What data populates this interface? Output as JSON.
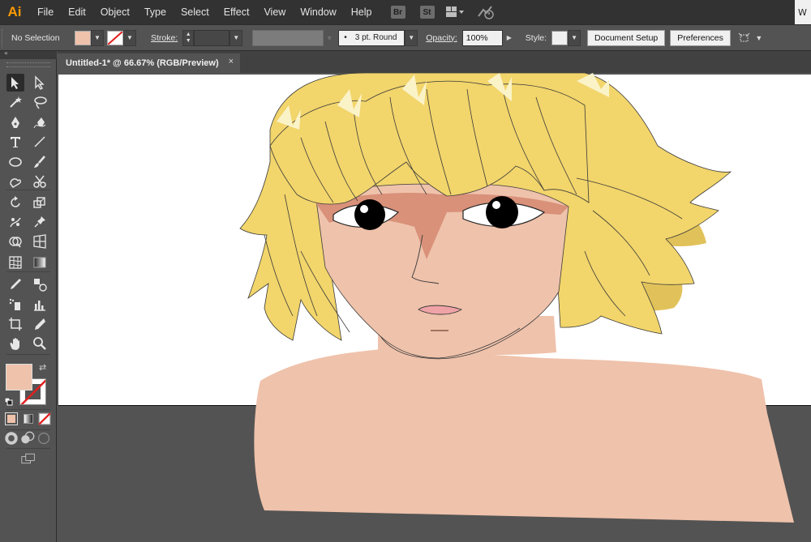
{
  "app": {
    "logo": "Ai"
  },
  "menu": {
    "items": [
      "File",
      "Edit",
      "Object",
      "Type",
      "Select",
      "Effect",
      "View",
      "Window",
      "Help"
    ],
    "bridge_label": "Br",
    "stock_label": "St",
    "right_fragment": "W"
  },
  "control": {
    "selection_label": "No Selection",
    "fill_color": "#efc2ab",
    "stroke_label": "Stroke:",
    "brush_label": "3 pt. Round",
    "opacity_label": "Opacity:",
    "opacity_value": "100%",
    "style_label": "Style:",
    "document_setup": "Document Setup",
    "preferences": "Preferences"
  },
  "document": {
    "tab_title": "Untitled-1* @ 66.67% (RGB/Preview)",
    "close_glyph": "×"
  },
  "tools": [
    "selection-tool",
    "direct-selection-tool",
    "magic-wand-tool",
    "lasso-tool",
    "pen-tool",
    "curvature-tool",
    "type-tool",
    "line-segment-tool",
    "ellipse-tool",
    "paintbrush-tool",
    "shaper-tool",
    "scissors-tool",
    "rotate-tool",
    "scale-tool",
    "puppet-warp-tool",
    "pin-tool",
    "shape-builder-tool",
    "perspective-grid-tool",
    "mesh-tool",
    "gradient-tool",
    "eyedropper-tool",
    "blend-tool",
    "symbol-sprayer-tool",
    "column-graph-tool",
    "artboard-tool",
    "slice-tool",
    "hand-tool",
    "zoom-tool"
  ],
  "colors": {
    "skin": "#efc2ab",
    "skin_shadow": "#d9917a",
    "hair": "#f2d56b",
    "hair_shadow": "#e1c25a",
    "hair_highlight": "#fbf3c8",
    "lips": "#f0a3a6",
    "fill_swatch": "#efc2ab"
  }
}
